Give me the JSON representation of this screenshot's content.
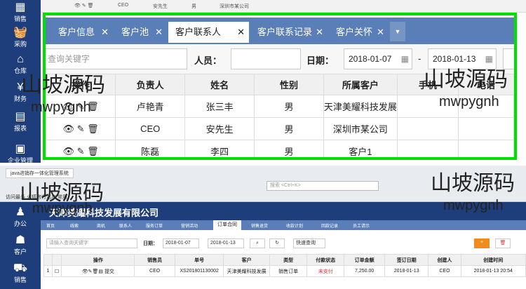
{
  "top_sidebar": {
    "items": [
      {
        "icon": "sales-icon",
        "label": "销售"
      },
      {
        "icon": "purchase-icon",
        "label": "采购"
      },
      {
        "icon": "warehouse-icon",
        "label": "仓库"
      },
      {
        "icon": "finance-icon",
        "label": "财务"
      },
      {
        "icon": "report-icon",
        "label": "报表"
      },
      {
        "icon": "enterprise-icon",
        "label": "企业管理"
      }
    ]
  },
  "top_strip": {
    "col1": "CEO",
    "col2": "安先生",
    "col3": "男",
    "col4": "深圳市某公司"
  },
  "tabs": [
    {
      "label": "客户信息",
      "active": false
    },
    {
      "label": "客户池",
      "active": false
    },
    {
      "label": "客户联系人",
      "active": true
    },
    {
      "label": "客户联系记录",
      "active": false
    },
    {
      "label": "客户关怀",
      "active": false
    }
  ],
  "tab_close": "✕",
  "filter": {
    "keyword_placeholder": "查询关键字",
    "person_label": "人员：",
    "date_label": "日期：",
    "date_from": "2018-01-07",
    "date_sep": "-",
    "date_to": "2018-01-13"
  },
  "table": {
    "headers": [
      "操作",
      "负责人",
      "姓名",
      "性别",
      "所属客户",
      "手机",
      "电话"
    ],
    "rows": [
      {
        "owner": "卢艳青",
        "name": "张三丰",
        "gender": "男",
        "customer": "天津美耀科技发展",
        "mobile": "",
        "phone": ""
      },
      {
        "owner": "CEO",
        "name": "安先生",
        "gender": "男",
        "customer": "深圳市某公司",
        "mobile": "",
        "phone": ""
      },
      {
        "owner": "陈磊",
        "name": "李四",
        "gender": "男",
        "customer": "客户1",
        "mobile": "",
        "phone": ""
      }
    ]
  },
  "watermark": {
    "cn": "山坡源码",
    "en": "mwpygnh"
  },
  "second": {
    "browser_title": "java进销存一体化管理系统",
    "url_text": "搜索 <Ctrl+K>",
    "bookmarks": "访问最多   火狐官方站点   常用",
    "company": "天津美耀科技发展有限公司",
    "side_items": [
      "办公",
      "客户",
      "销售"
    ],
    "tabs": [
      "首页",
      "线索",
      "商机",
      "联系人",
      "服务订单",
      "营销活动",
      "订单合同",
      "销售退货",
      "收款计划",
      "回款记录",
      "员工请示"
    ],
    "active_tab": "订单合同",
    "search_placeholder": "请输入查询关键字",
    "date_label": "日期：",
    "date_from": "2018-01-07",
    "date_to": "2018-01-13",
    "quick_query": "快速查询",
    "headers": [
      "",
      "",
      "操作",
      "销售员",
      "单号",
      "客户",
      "类型",
      "付款状态",
      "订单金额",
      "签订日期",
      "创建人",
      "创建时间"
    ],
    "row": [
      "1",
      "",
      "提交",
      "CEO",
      "XS201801130002",
      "天津美耀科技发展",
      "销售订单",
      "未支付",
      "7,250.00",
      "2018-01-13",
      "CEO",
      "2018-01-13 20:54"
    ]
  }
}
